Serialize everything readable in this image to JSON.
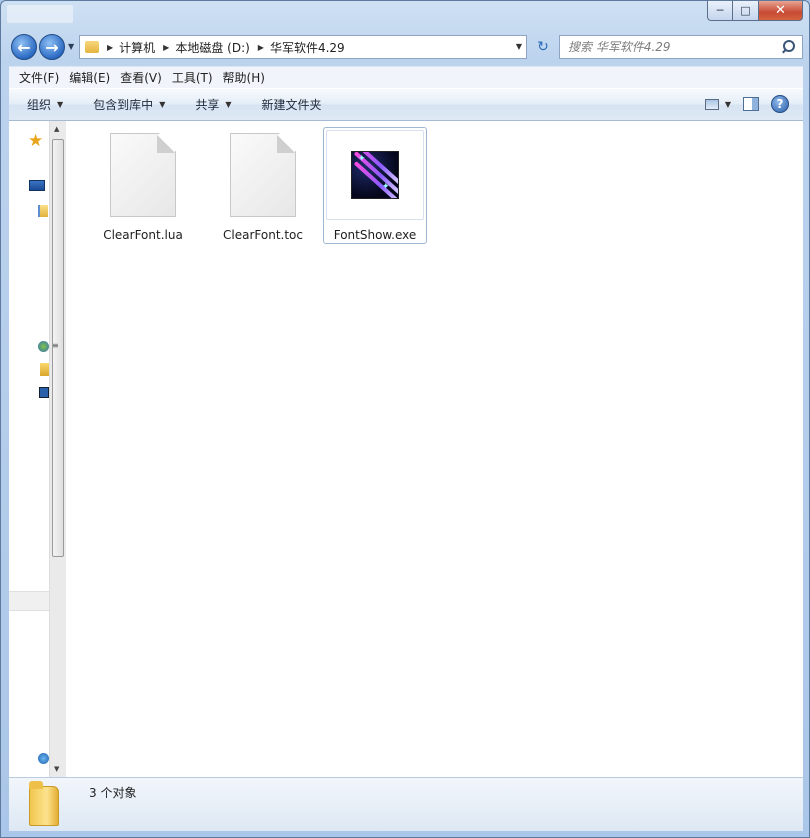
{
  "window": {
    "close_glyph": "✕",
    "minimize_glyph": "─",
    "maximize_glyph": "□"
  },
  "nav": {
    "back_glyph": "←",
    "forward_glyph": "→",
    "breadcrumb": [
      "计算机",
      "本地磁盘 (D:)",
      "华军软件4.29"
    ]
  },
  "search": {
    "placeholder": "搜索 华军软件4.29"
  },
  "menubar": {
    "items": [
      "文件(F)",
      "编辑(E)",
      "查看(V)",
      "工具(T)",
      "帮助(H)"
    ]
  },
  "commandbar": {
    "organize": "组织",
    "include_in_library": "包含到库中",
    "share": "共享",
    "new_folder": "新建文件夹",
    "help_glyph": "?"
  },
  "files": [
    {
      "name": "ClearFont.lua",
      "icon": "document-icon"
    },
    {
      "name": "ClearFont.toc",
      "icon": "document-icon"
    },
    {
      "name": "FontShow.exe",
      "icon": "fontshow-app-icon",
      "selected": true
    }
  ],
  "details": {
    "count_text": "3 个对象"
  },
  "colors": {
    "frame": "#bcd3ee",
    "close_button": "#c74a33",
    "selection_border": "#9fb6d2"
  }
}
